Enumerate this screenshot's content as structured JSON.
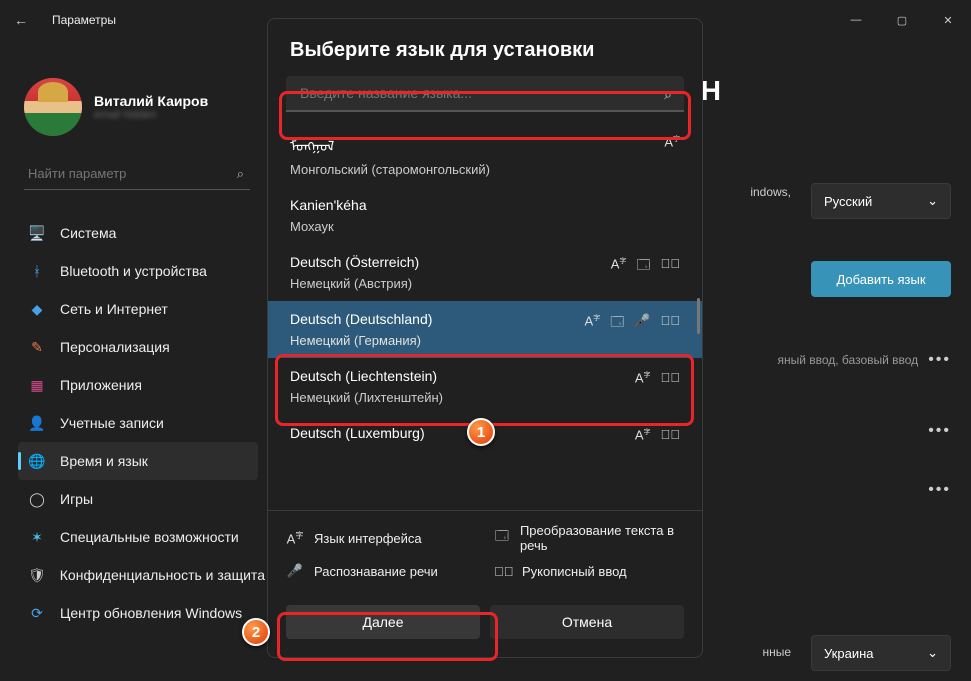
{
  "titlebar": {
    "title": "Параметры"
  },
  "profile": {
    "name": "Виталий Каиров",
    "email": "email hidden"
  },
  "sidebar_search": {
    "placeholder": "Найти параметр"
  },
  "sidebar": {
    "items": [
      {
        "label": "Система",
        "icon": "🖥️",
        "color": "#4aa0e8"
      },
      {
        "label": "Bluetooth и устройства",
        "icon": "ᚼ",
        "color": "#4aa0e8"
      },
      {
        "label": "Сеть и Интернет",
        "icon": "◆",
        "color": "#4aa0e8"
      },
      {
        "label": "Персонализация",
        "icon": "✎",
        "color": "#e87a4a"
      },
      {
        "label": "Приложения",
        "icon": "▦",
        "color": "#d64a8a"
      },
      {
        "label": "Учетные записи",
        "icon": "👤",
        "color": "#e8a04a"
      },
      {
        "label": "Время и язык",
        "icon": "🌐",
        "color": "#60cdff",
        "active": true
      },
      {
        "label": "Игры",
        "icon": "◯",
        "color": "#ccc"
      },
      {
        "label": "Специальные возможности",
        "icon": "✶",
        "color": "#4ac0e8"
      },
      {
        "label": "Конфиденциальность и защита",
        "icon": "🛡",
        "color": "#ccc"
      },
      {
        "label": "Центр обновления Windows",
        "icon": "⟳",
        "color": "#4aa0e8"
      }
    ]
  },
  "main": {
    "heading_tail": "ОН",
    "windows_tail": "indows,",
    "display_lang": "Русский",
    "add_language": "Добавить язык",
    "tags1": "яный ввод, базовый ввод",
    "region_tail": "нные",
    "region_value": "Украина"
  },
  "dialog": {
    "title": "Выберите язык для установки",
    "search_placeholder": "Введите название языка...",
    "languages": [
      {
        "native": "ᠮᠣᠩᠭᠣᠯ",
        "local": "Монгольский (старомонгольский)",
        "icons": [
          "A"
        ]
      },
      {
        "native": "Kanien'kéha",
        "local": "Мохаук",
        "icons": []
      },
      {
        "native": "Deutsch (Österreich)",
        "local": "Немецкий (Австрия)",
        "icons": [
          "A",
          "tts",
          "pen"
        ]
      },
      {
        "native": "Deutsch (Deutschland)",
        "local": "Немецкий (Германия)",
        "icons": [
          "A",
          "tts",
          "mic",
          "pen"
        ],
        "selected": true
      },
      {
        "native": "Deutsch (Liechtenstein)",
        "local": "Немецкий (Лихтенштейн)",
        "icons": [
          "A",
          "pen"
        ]
      },
      {
        "native": "Deutsch (Luxemburg)",
        "local": "",
        "icons": [
          "A",
          "pen"
        ]
      }
    ],
    "legend": {
      "display": "Язык интерфейса",
      "tts": "Преобразование текста в речь",
      "speech": "Распознавание речи",
      "handwriting": "Рукописный ввод"
    },
    "buttons": {
      "next": "Далее",
      "cancel": "Отмена"
    }
  },
  "callouts": {
    "one": "1",
    "two": "2"
  }
}
